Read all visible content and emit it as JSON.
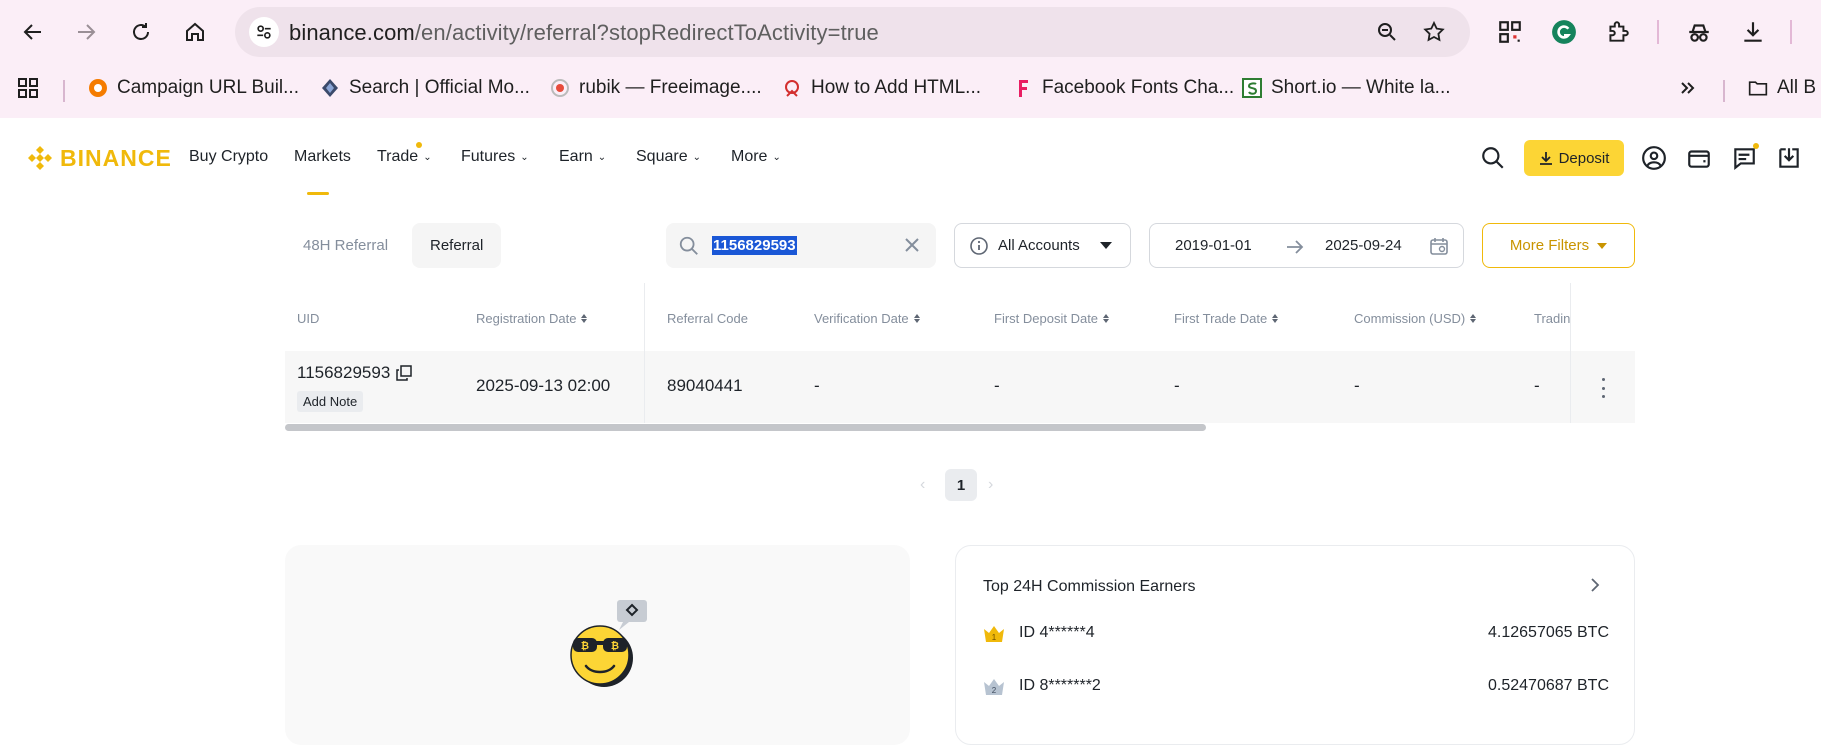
{
  "browser": {
    "url_main": "binance.com",
    "url_rest": "/en/activity/referral?stopRedirectToActivity=true",
    "bookmarks": [
      {
        "label": "Campaign URL Buil..."
      },
      {
        "label": "Search | Official Mo..."
      },
      {
        "label": "rubik — Freeimage...."
      },
      {
        "label": "How to Add HTML..."
      },
      {
        "label": "Facebook Fonts Cha..."
      },
      {
        "label": "Short.io — White la..."
      },
      {
        "label": "All B"
      }
    ]
  },
  "header": {
    "brand": "BINANCE",
    "nav": [
      "Buy Crypto",
      "Markets",
      "Trade",
      "Futures",
      "Earn",
      "Square",
      "More"
    ],
    "deposit_label": "Deposit",
    "accent": "#f0b90b"
  },
  "filters": {
    "tabs": [
      "48H Referral",
      "Referral"
    ],
    "active_tab": "Referral",
    "search_value": "1156829593",
    "account_select": "All Accounts",
    "date_from": "2019-01-01",
    "date_to": "2025-09-24",
    "more_filters": "More Filters"
  },
  "table": {
    "columns": [
      "UID",
      "Registration Date",
      "Referral Code",
      "Verification Date",
      "First Deposit Date",
      "First Trade Date",
      "Commission (USD)",
      "Tradin"
    ],
    "rows": [
      {
        "uid": "1156829593",
        "note": "Add Note",
        "registration_date": "2025-09-13 02:00",
        "referral_code": "89040441",
        "verification_date": "-",
        "first_deposit_date": "-",
        "first_trade_date": "-",
        "commission": "-",
        "trading": "-"
      }
    ]
  },
  "pagination": {
    "current": "1"
  },
  "earners": {
    "title": "Top 24H Commission Earners",
    "items": [
      {
        "rank": "1",
        "id": "ID 4******4",
        "value": "4.12657065 BTC"
      },
      {
        "rank": "2",
        "id": "ID 8*******2",
        "value": "0.52470687 BTC"
      }
    ]
  }
}
